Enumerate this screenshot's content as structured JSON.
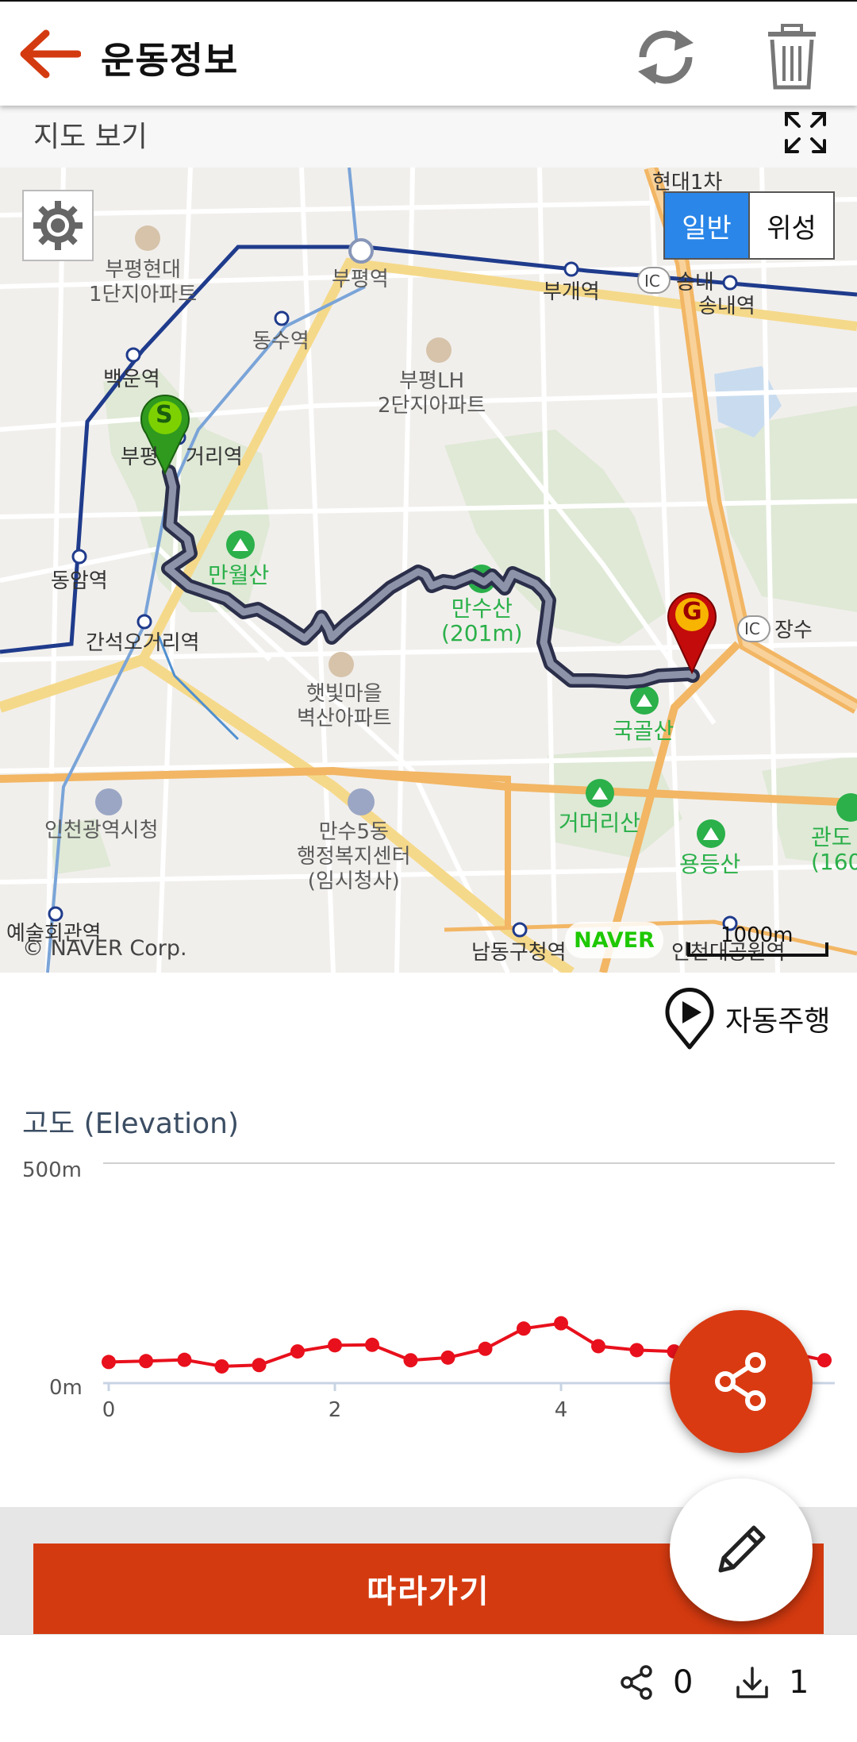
{
  "header": {
    "title": "운동정보",
    "back_icon": "back-arrow-icon",
    "refresh_icon": "refresh-icon",
    "delete_icon": "trash-icon",
    "accent_color": "#d43a10"
  },
  "map": {
    "section_label": "지도 보기",
    "fullscreen_icon": "fullscreen-icon",
    "settings_icon": "gear-icon",
    "map_types": [
      "일반",
      "위성"
    ],
    "selected_map_type": "일반",
    "copyright": "© NAVER Corp.",
    "provider_logo": "NAVER",
    "scale": "1000m",
    "labels": {
      "l1": "부평현대\n1단지아파트",
      "l2": "부평역",
      "l3": "부개역",
      "l4": "송내",
      "l5": "송내역",
      "l6": "현대1차",
      "l7": "동수역",
      "l8": "부평LH\n2단지아파트",
      "l9": "백운역",
      "l10": "부평",
      "l10b": "거리역",
      "l11": "동암역",
      "l12": "만월산",
      "l13": "만수산\n(201m)",
      "l14": "간석오거리역",
      "l15": "햇빛마을\n벽산아파트",
      "l16": "장수",
      "l17": "국골산",
      "l18": "인천광역시청",
      "l19": "만수5동\n행정복지센터\n(임시청사)",
      "l20": "거머리산",
      "l21": "용등산",
      "l22": "관도\n(160",
      "l23": "예술회관역",
      "l24": "남동구청역",
      "l25": "인천대공원역",
      "ic1": "IC",
      "ic2": "IC"
    },
    "start_marker": "S",
    "goal_marker": "G"
  },
  "autoplay": {
    "label": "자동주행",
    "icon": "play-location-icon"
  },
  "chart_data": {
    "type": "line",
    "title": "고도 (Elevation)",
    "xlabel": "",
    "ylabel": "",
    "ylim": [
      0,
      500
    ],
    "yticks": [
      "500m",
      "0m"
    ],
    "xticks": [
      "0",
      "2",
      "4"
    ],
    "grid": "horizontal",
    "color": "#e8101c",
    "x": [
      0,
      0.33,
      0.67,
      1.0,
      1.33,
      1.67,
      2.0,
      2.33,
      2.67,
      3.0,
      3.33,
      3.67,
      4.0,
      4.33,
      4.67,
      5.0,
      5.33,
      5.67,
      6.0,
      6.33
    ],
    "values": [
      48,
      50,
      53,
      38,
      41,
      72,
      86,
      87,
      52,
      58,
      78,
      124,
      136,
      84,
      75,
      72,
      60,
      52,
      70,
      52
    ]
  },
  "fab": {
    "share_icon": "share-icon",
    "edit_icon": "pencil-icon"
  },
  "follow_button": "따라가기",
  "stats": {
    "share_count": "0",
    "download_count": "1",
    "share_icon": "share-icon",
    "download_icon": "download-icon"
  }
}
